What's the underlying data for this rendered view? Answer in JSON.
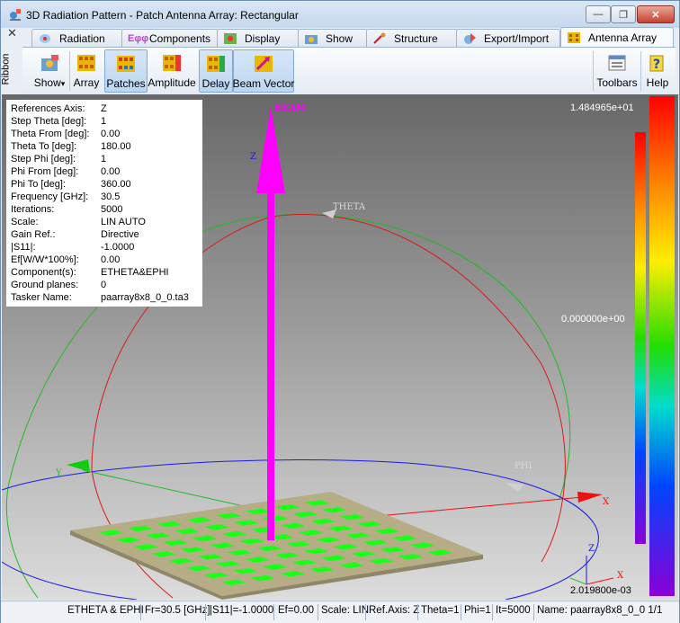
{
  "window": {
    "title": "3D Radiation Pattern - Patch Antenna Array: Rectangular",
    "minimize_glyph": "—",
    "restore_glyph": "❐",
    "close_glyph": "✕"
  },
  "ribbon": {
    "side_label": "Ribbon",
    "collapse_glyph": "✕",
    "tabs": [
      {
        "label": "Radiation",
        "icon": "radiation-icon"
      },
      {
        "label": "Components",
        "icon": "components-icon"
      },
      {
        "label": "Display",
        "icon": "display-icon"
      },
      {
        "label": "Show",
        "icon": "show-icon"
      },
      {
        "label": "Structure",
        "icon": "structure-icon"
      },
      {
        "label": "Export/Import",
        "icon": "export-import-icon"
      },
      {
        "label": "Antenna Array",
        "icon": "antenna-array-icon",
        "active": true
      }
    ],
    "components_tab_icon_text": "Eφφ",
    "buttons": [
      {
        "label": "Show",
        "dropdown": true
      },
      {
        "label": "Array"
      },
      {
        "label": "Patches",
        "selected": true
      },
      {
        "label": "Amplitude"
      },
      {
        "label": "Delay",
        "selected": true
      },
      {
        "label": "Beam Vector",
        "selected": true
      },
      {
        "label": "Toolbars"
      },
      {
        "label": "Help"
      }
    ],
    "dropdown_glyph": "▾"
  },
  "info": [
    {
      "key": "References Axis:",
      "value": "Z"
    },
    {
      "key": "Step Theta [deg]:",
      "value": "1"
    },
    {
      "key": "Theta From [deg]:",
      "value": "0.00"
    },
    {
      "key": "Theta To [deg]:",
      "value": "180.00"
    },
    {
      "key": "Step Phi [deg]:",
      "value": "1"
    },
    {
      "key": "Phi From [deg]:",
      "value": "0.00"
    },
    {
      "key": "Phi To [deg]:",
      "value": "360.00"
    },
    {
      "key": "Frequency [GHz]:",
      "value": "30.5"
    },
    {
      "key": "Iterations:",
      "value": "5000"
    },
    {
      "key": "Scale:",
      "value": "LIN AUTO"
    },
    {
      "key": "Gain Ref.:",
      "value": "Directive"
    },
    {
      "key": "|S11|:",
      "value": "-1.0000"
    },
    {
      "key": "Ef[W/W*100%]:",
      "value": "0.00"
    },
    {
      "key": "Component(s):",
      "value": "ETHETA&EPHI"
    },
    {
      "key": "Ground planes:",
      "value": "0"
    },
    {
      "key": "Tasker Name:",
      "value": "paarray8x8_0_0.ta3"
    }
  ],
  "scene": {
    "scale_max": "1.484965e+01",
    "scale_mid": "0.000000e+00",
    "scale_min": "2.019800e-03",
    "labels": {
      "z_axis": "Z",
      "beam": "BEAM",
      "theta": "THETA",
      "phi": "PHI",
      "x_axis": "X",
      "y_axis": "Y",
      "mini_z": "Z",
      "mini_x": "X"
    },
    "colors": {
      "beam": "#ff00ff",
      "patch": "#19ff19",
      "substrate": "#b6ad86",
      "theta_arc": "#dd1a1a",
      "phi_arc": "#1a1aee",
      "green_arc": "#22bb22",
      "x_arrow": "#ee1111",
      "y_arrow": "#11cc11"
    }
  },
  "status": [
    "ETHETA & EPHI",
    "Fr=30.5 [GHz]",
    "|S11|=-1.0000",
    "Ef=0.00",
    "Scale: LIN",
    "Ref.Axis: Z",
    "Theta=1",
    "Phi=1",
    "It=5000",
    "Name: paarray8x8_0_0 1/1"
  ]
}
